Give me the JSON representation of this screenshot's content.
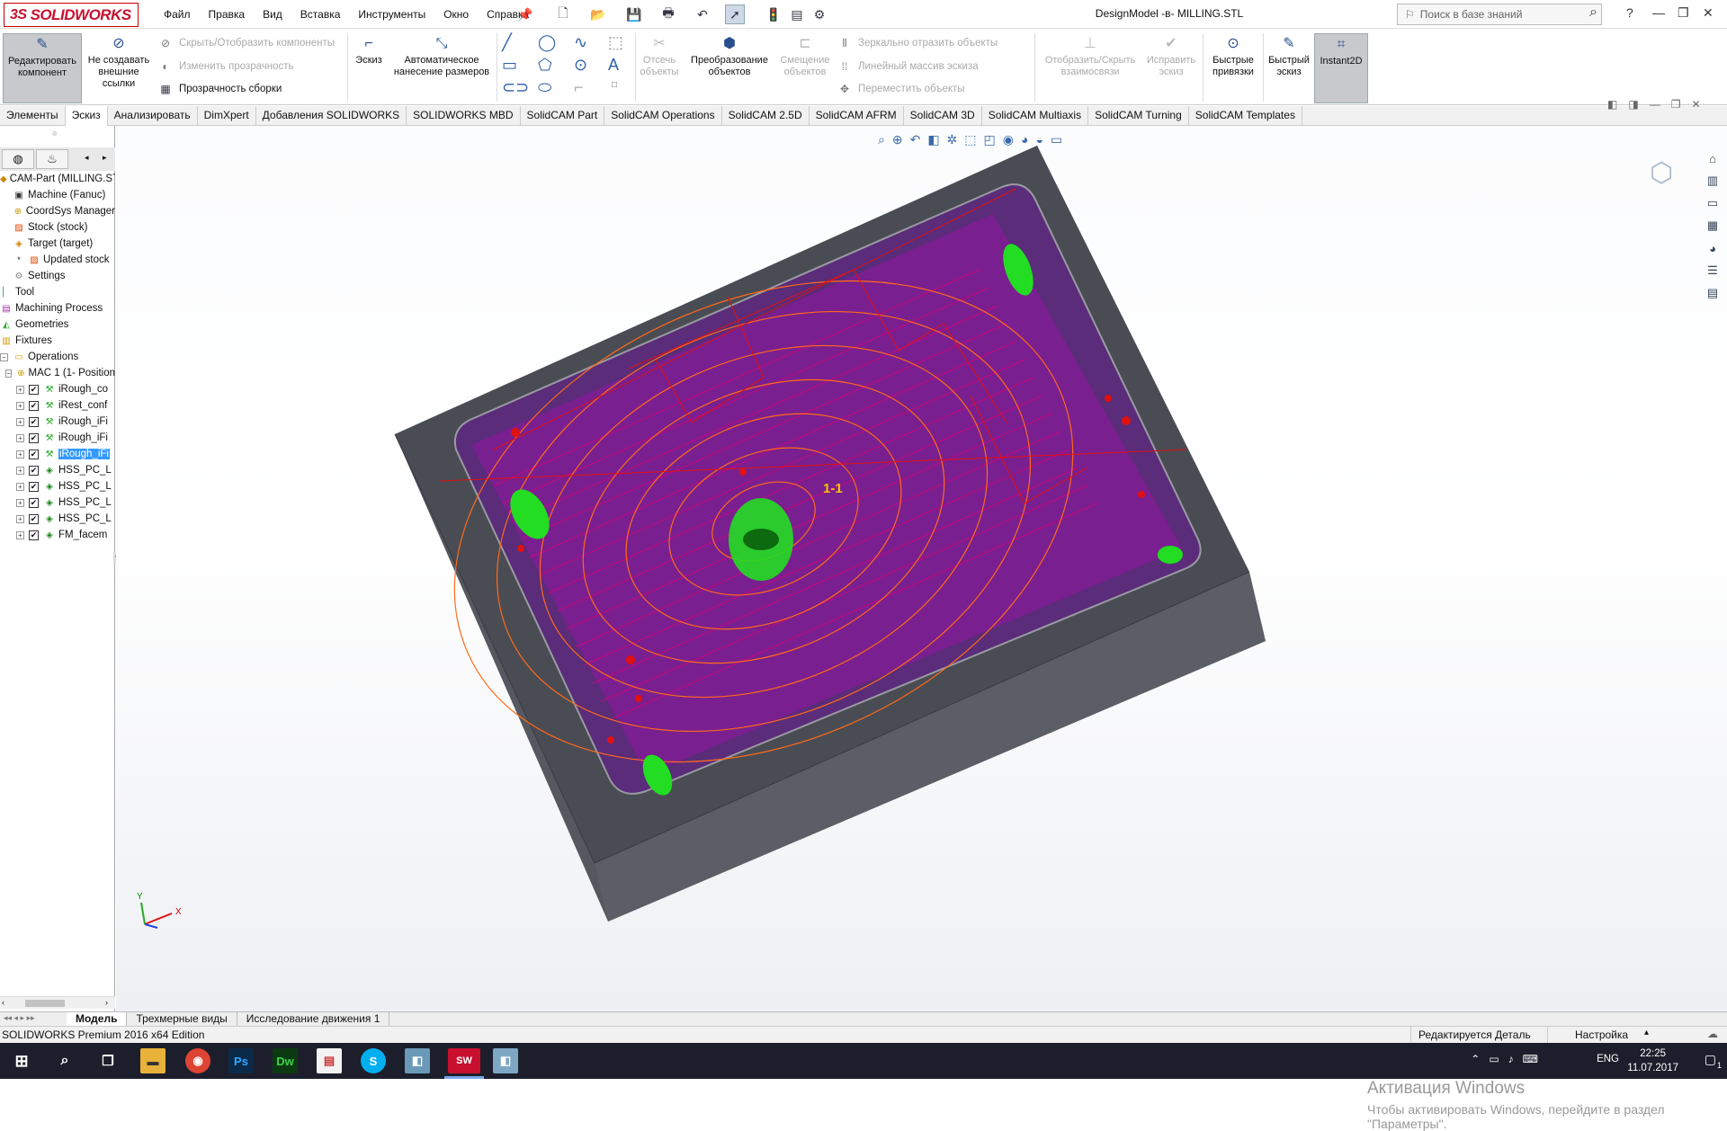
{
  "app": {
    "brand": "SOLIDWORKS",
    "brand_prefix": "3S",
    "document_title": "DesignModel -в- MILLING.STL"
  },
  "menu": [
    "Файл",
    "Правка",
    "Вид",
    "Вставка",
    "Инструменты",
    "Окно",
    "Справка"
  ],
  "search": {
    "placeholder": "Поиск в базе знаний"
  },
  "ribbon": {
    "edit_component": "Редактировать компонент",
    "no_external_refs": "Не создавать внешние ссылки",
    "hide_show_components": "Скрыть/Отобразить компоненты",
    "change_transparency": "Изменить прозрачность",
    "assembly_transparency": "Прозрачность сборки",
    "sketch": "Эскиз",
    "smart_dimension": "Автоматическое нанесение размеров",
    "trim_entities": "Отсечь объекты",
    "convert_entities": "Преобразование объектов",
    "offset_entities": "Смещение объектов",
    "mirror_entities": "Зеркально отразить объекты",
    "linear_pattern": "Линейный массив эскиза",
    "move_entities": "Переместить объекты",
    "display_relations": "Отобразить/Скрыть взаимосвязи",
    "repair_sketch": "Исправить эскиз",
    "quick_snaps": "Быстрые привязки",
    "rapid_sketch": "Быстрый эскиз",
    "instant2d": "Instant2D"
  },
  "tabs": [
    "Элементы",
    "Эскиз",
    "Анализировать",
    "DimXpert",
    "Добавления SOLIDWORKS",
    "SOLIDWORKS MBD",
    "SolidCAM Part",
    "SolidCAM Operations",
    "SolidCAM 2.5D",
    "SolidCAM AFRM",
    "SolidCAM 3D",
    "SolidCAM Multiaxis",
    "SolidCAM Turning",
    "SolidCAM Templates"
  ],
  "active_tab": "Эскиз",
  "tree": {
    "root": "CAM-Part (MILLING.STL",
    "machine": "Machine (Fanuc)",
    "coordsys": "CoordSys Manager",
    "stock": "Stock (stock)",
    "target": "Target (target)",
    "updated_stock": "Updated stock",
    "settings": "Settings",
    "tool": "Tool",
    "machining_process": "Machining Process",
    "geometries": "Geometries",
    "fixtures": "Fixtures",
    "operations": "Operations",
    "mac": "MAC 1 (1- Position",
    "ops": [
      "iRough_co",
      "iRest_conf",
      "iRough_iFi",
      "iRough_iFi",
      "iRough_iFi",
      "HSS_PC_L",
      "HSS_PC_L",
      "HSS_PC_L",
      "HSS_PC_L",
      "FM_facem"
    ],
    "selected_op_index": 4
  },
  "viewport": {
    "label_marker": "1-1",
    "triad_x": "X",
    "triad_y": "Y"
  },
  "activation": {
    "title": "Активация Windows",
    "subtitle": "Чтобы активировать Windows, перейдите в раздел \"Параметры\"."
  },
  "bottom_tabs": [
    "Модель",
    "Трехмерные виды",
    "Исследование движения 1"
  ],
  "status": {
    "left": "SOLIDWORKS Premium 2016 x64 Edition",
    "editing": "Редактируется Деталь",
    "settings": "Настройка"
  },
  "taskbar": {
    "lang": "ENG",
    "time": "22:25",
    "date": "11.07.2017",
    "notifications": "1"
  },
  "colors": {
    "brand_red": "#c8102e",
    "selection_blue": "#3399ff",
    "taskbar": "#1c1f2b",
    "toolpath_magenta": "#d6007c",
    "toolpath_red": "#e01010",
    "toolpath_green": "#22dd22",
    "stock_gray": "#55575e"
  }
}
